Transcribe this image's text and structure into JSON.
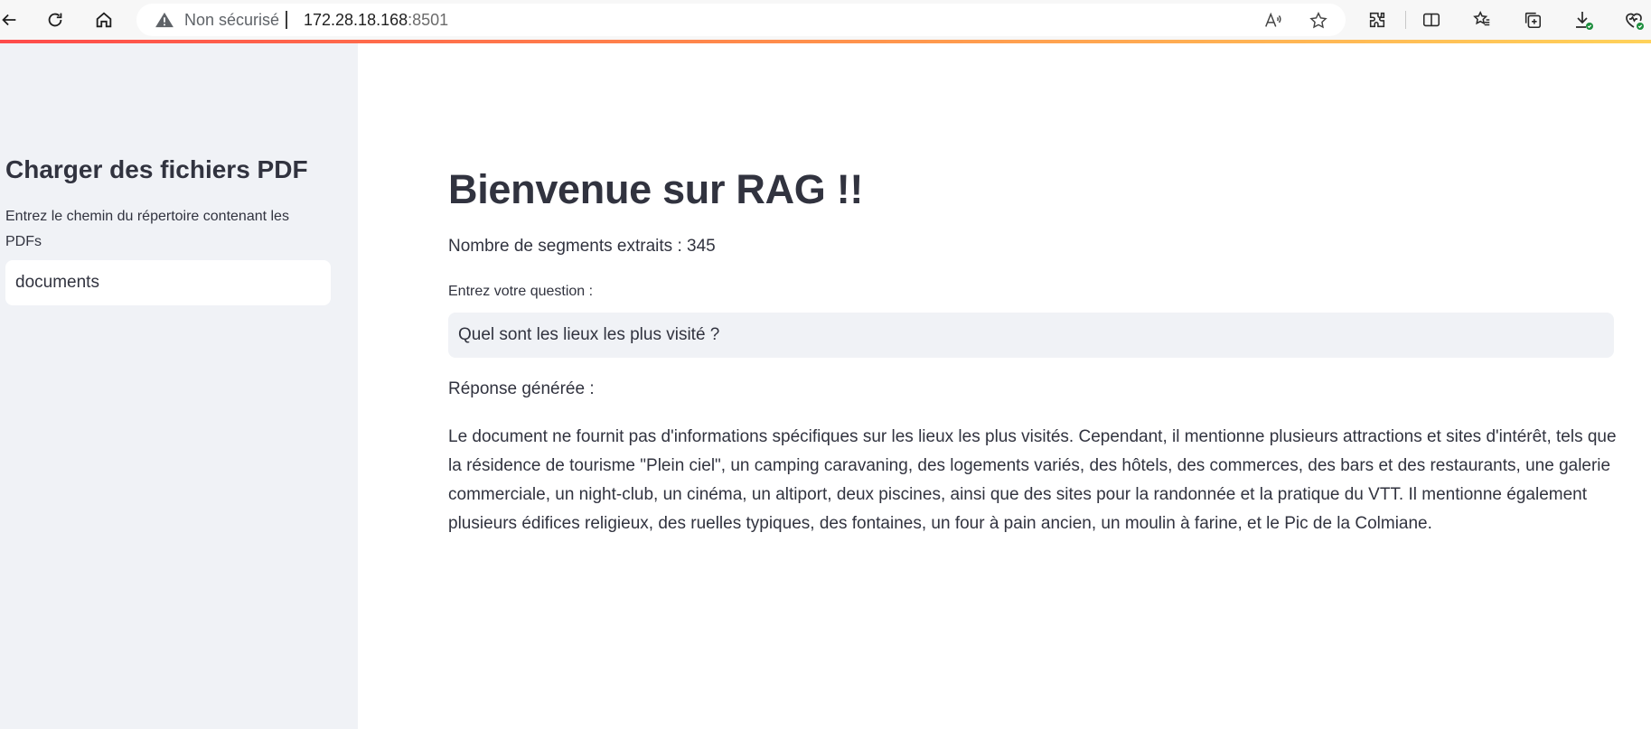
{
  "browser": {
    "security_label": "Non sécurisé",
    "url_host": "172.28.18.168",
    "url_port": ":8501",
    "progress_gradient": [
      "#ff4b4b",
      "#ff8a4b",
      "#ffd25a"
    ],
    "nav_icons": [
      "back-arrow-icon",
      "reload-icon",
      "home-icon"
    ],
    "address_icons": [
      "warning-triangle-icon",
      "read-aloud-icon",
      "favorite-star-icon"
    ],
    "toolbar_icons": [
      "extensions-icon",
      "split-screen-icon",
      "favorites-icon",
      "collections-icon",
      "downloads-icon",
      "browser-essentials-icon"
    ]
  },
  "sidebar": {
    "title": "Charger des fichiers PDF",
    "help_text": "Entrez le chemin du répertoire contenant les PDFs",
    "path_value": "documents"
  },
  "main": {
    "title": "Bienvenue sur RAG !!",
    "segments_text": "Nombre de segments extraits : 345",
    "question_label": "Entrez votre question :",
    "question_value": "Quel sont les lieux les plus visité ?",
    "response_label": "Réponse générée :",
    "response_text": "Le document ne fournit pas d'informations spécifiques sur les lieux les plus visités. Cependant, il mentionne plusieurs attractions et sites d'intérêt, tels que la résidence de tourisme \"Plein ciel\", un camping caravaning, des logements variés, des hôtels, des commerces, des bars et des restaurants, une galerie commerciale, un night-club, un cinéma, un altiport, deux piscines, ainsi que des sites pour la randonnée et la pratique du VTT. Il mentionne également plusieurs édifices religieux, des ruelles typiques, des fontaines, un four à pain ancien, un moulin à farine, et le Pic de la Colmiane."
  },
  "colors": {
    "sidebar_bg": "#f0f2f6",
    "text": "#31333f",
    "input_bg": "#f0f2f6"
  }
}
